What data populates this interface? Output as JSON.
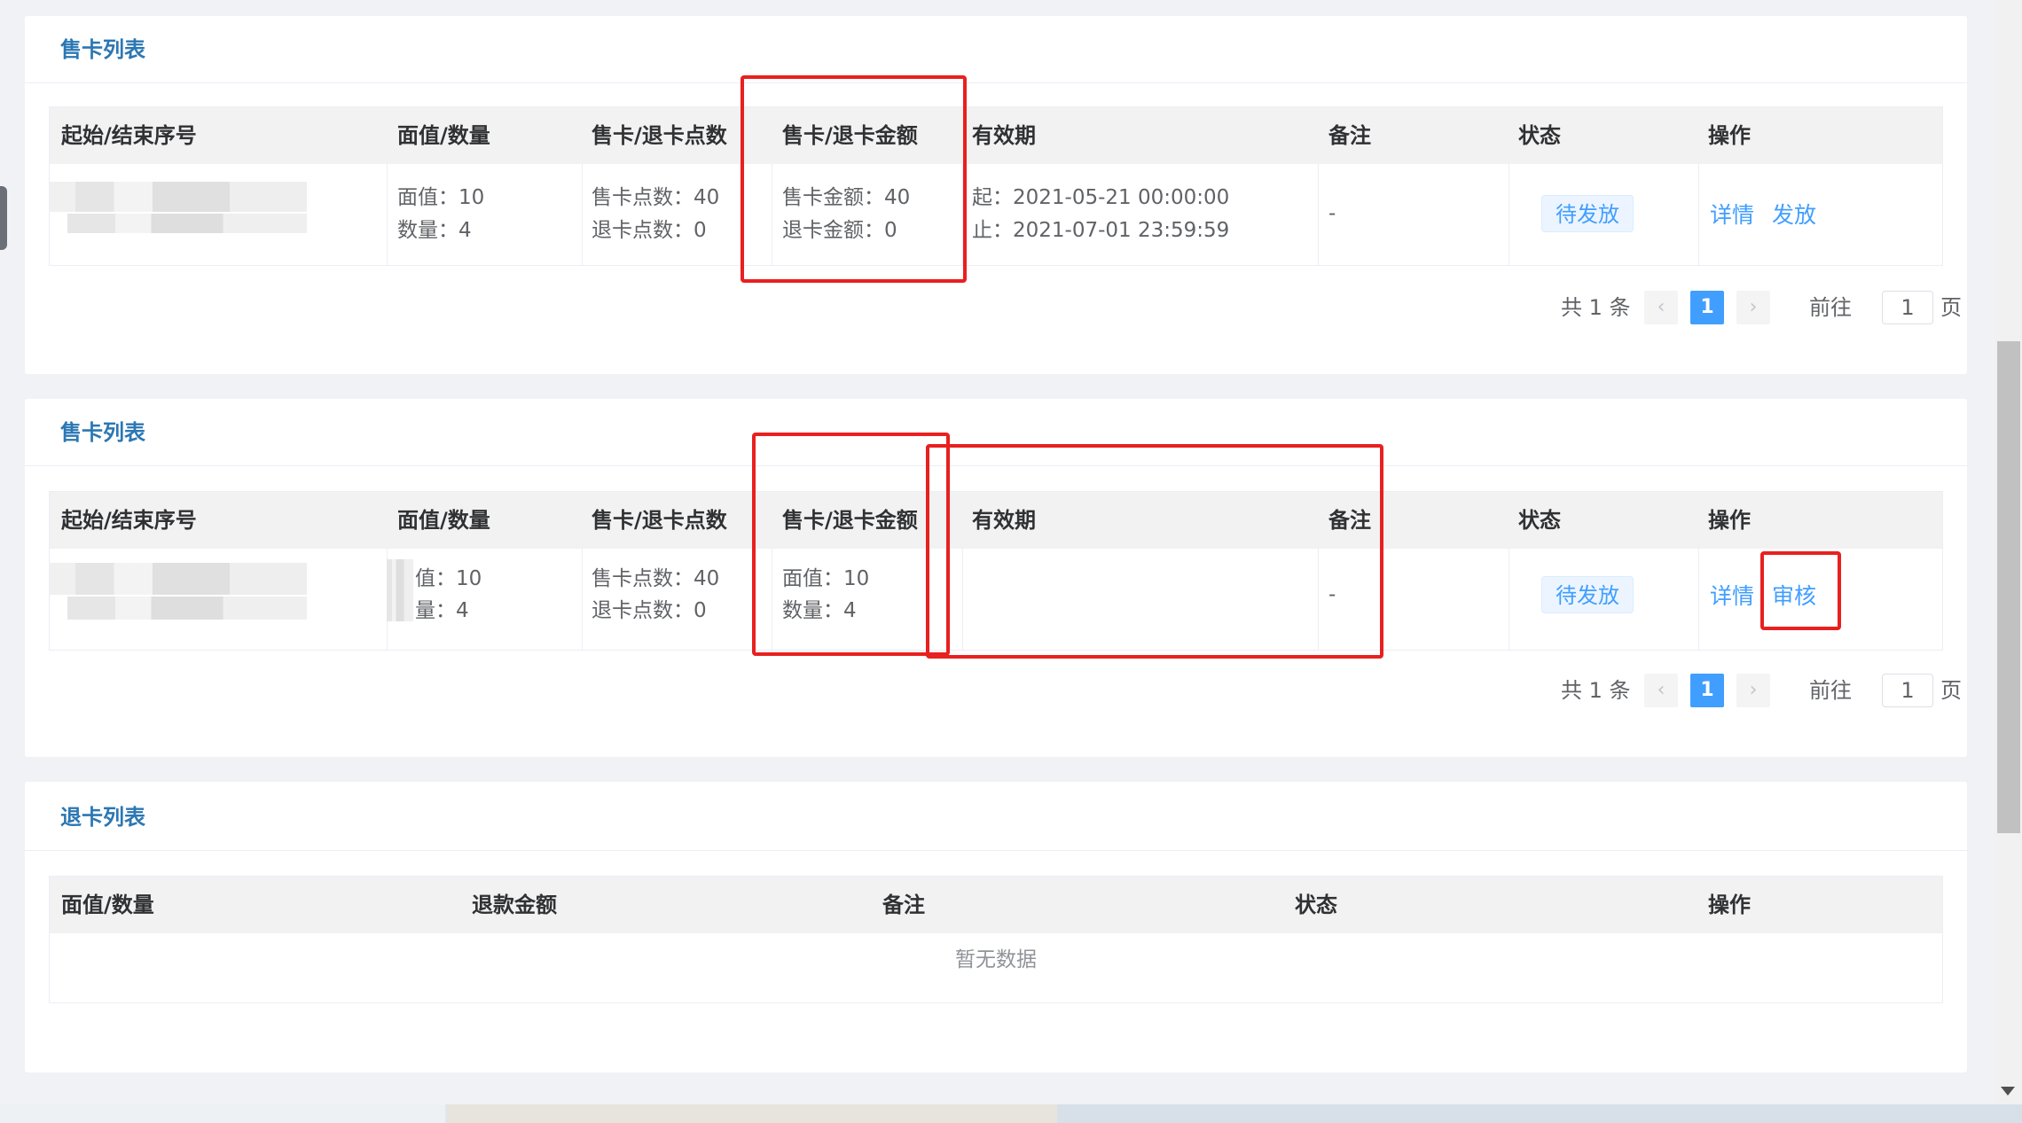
{
  "sale_list_1": {
    "title": "售卡列表",
    "headers": [
      "起始/结束序号",
      "面值/数量",
      "售卡/退卡点数",
      "售卡/退卡金额",
      "有效期",
      "备注",
      "状态",
      "操作"
    ],
    "row": {
      "face_line1": "面值：10",
      "face_line2": "数量：4",
      "points_line1": "售卡点数：40",
      "points_line2": "退卡点数：0",
      "amount_line1": "售卡金额：40",
      "amount_line2": "退卡金额：0",
      "validity_line1": "起：2021-05-21 00:00:00",
      "validity_line2": "止：2021-07-01 23:59:59",
      "remark": "-",
      "status": "待发放",
      "action_detail": "详情",
      "action_second": "发放"
    },
    "pagination": {
      "total_text": "共 1 条",
      "prev": "‹",
      "page": "1",
      "next": "›",
      "goto_label": "前往",
      "goto_value": "1",
      "page_suffix": "页"
    }
  },
  "sale_list_2": {
    "title": "售卡列表",
    "headers": [
      "起始/结束序号",
      "面值/数量",
      "售卡/退卡点数",
      "售卡/退卡金额",
      "有效期",
      "备注",
      "状态",
      "操作"
    ],
    "row": {
      "face_line1": "值：10",
      "face_line2": "量：4",
      "points_line1": "售卡点数：40",
      "points_line2": "退卡点数：0",
      "amount_line1": "面值：10",
      "amount_line2": "数量：4",
      "remark": "-",
      "status": "待发放",
      "action_detail": "详情",
      "action_second": "审核"
    },
    "pagination": {
      "total_text": "共 1 条",
      "prev": "‹",
      "page": "1",
      "next": "›",
      "goto_label": "前往",
      "goto_value": "1",
      "page_suffix": "页"
    }
  },
  "refund_list": {
    "title": "退卡列表",
    "headers": [
      "面值/数量",
      "退款金额",
      "备注",
      "状态",
      "操作"
    ],
    "empty_text": "暂无数据"
  },
  "colors": {
    "link": "#409eff",
    "title": "#2b77b3",
    "highlight_box": "#e8201f"
  }
}
